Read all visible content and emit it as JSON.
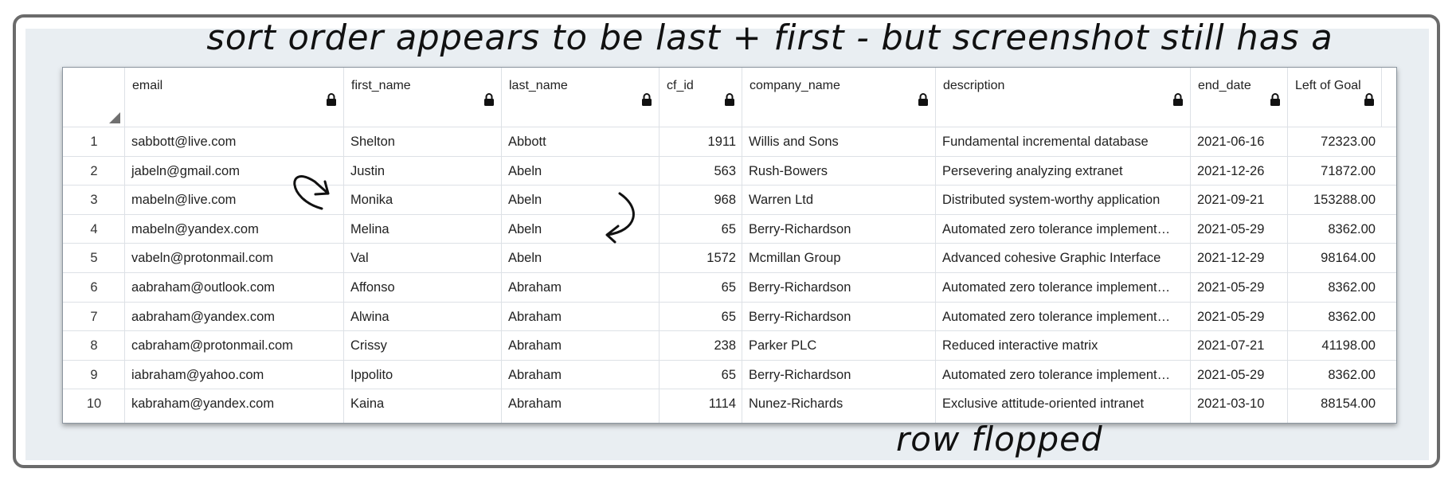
{
  "annotations": {
    "top_note": "sort order appears to be last + first - but screenshot still has a",
    "bottom_note": "row flopped"
  },
  "table": {
    "columns": [
      {
        "label": "",
        "key": "rownum"
      },
      {
        "label": "email",
        "key": "email"
      },
      {
        "label": "first_name",
        "key": "first_name"
      },
      {
        "label": "last_name",
        "key": "last_name"
      },
      {
        "label": "cf_id",
        "key": "cf_id"
      },
      {
        "label": "company_name",
        "key": "company_name"
      },
      {
        "label": "description",
        "key": "description"
      },
      {
        "label": "end_date",
        "key": "end_date"
      },
      {
        "label": "Left of Goal",
        "key": "left_of_goal"
      }
    ],
    "rows": [
      {
        "rownum": "1",
        "email": "sabbott@live.com",
        "first_name": "Shelton",
        "last_name": "Abbott",
        "cf_id": "1911",
        "company_name": "Willis and Sons",
        "description": "Fundamental incremental database",
        "end_date": "2021-06-16",
        "left_of_goal": "72323.00"
      },
      {
        "rownum": "2",
        "email": "jabeln@gmail.com",
        "first_name": "Justin",
        "last_name": "Abeln",
        "cf_id": "563",
        "company_name": "Rush-Bowers",
        "description": "Persevering analyzing extranet",
        "end_date": "2021-12-26",
        "left_of_goal": "71872.00"
      },
      {
        "rownum": "3",
        "email": "mabeln@live.com",
        "first_name": "Monika",
        "last_name": "Abeln",
        "cf_id": "968",
        "company_name": "Warren Ltd",
        "description": "Distributed system-worthy application",
        "end_date": "2021-09-21",
        "left_of_goal": "153288.00"
      },
      {
        "rownum": "4",
        "email": "mabeln@yandex.com",
        "first_name": "Melina",
        "last_name": "Abeln",
        "cf_id": "65",
        "company_name": "Berry-Richardson",
        "description": "Automated zero tolerance implement…",
        "end_date": "2021-05-29",
        "left_of_goal": "8362.00"
      },
      {
        "rownum": "5",
        "email": "vabeln@protonmail.com",
        "first_name": "Val",
        "last_name": "Abeln",
        "cf_id": "1572",
        "company_name": "Mcmillan Group",
        "description": "Advanced cohesive Graphic Interface",
        "end_date": "2021-12-29",
        "left_of_goal": "98164.00"
      },
      {
        "rownum": "6",
        "email": "aabraham@outlook.com",
        "first_name": "Affonso",
        "last_name": "Abraham",
        "cf_id": "65",
        "company_name": "Berry-Richardson",
        "description": "Automated zero tolerance implement…",
        "end_date": "2021-05-29",
        "left_of_goal": "8362.00"
      },
      {
        "rownum": "7",
        "email": "aabraham@yandex.com",
        "first_name": "Alwina",
        "last_name": "Abraham",
        "cf_id": "65",
        "company_name": "Berry-Richardson",
        "description": "Automated zero tolerance implement…",
        "end_date": "2021-05-29",
        "left_of_goal": "8362.00"
      },
      {
        "rownum": "8",
        "email": "cabraham@protonmail.com",
        "first_name": "Crissy",
        "last_name": "Abraham",
        "cf_id": "238",
        "company_name": "Parker PLC",
        "description": "Reduced interactive matrix",
        "end_date": "2021-07-21",
        "left_of_goal": "41198.00"
      },
      {
        "rownum": "9",
        "email": "iabraham@yahoo.com",
        "first_name": "Ippolito",
        "last_name": "Abraham",
        "cf_id": "65",
        "company_name": "Berry-Richardson",
        "description": "Automated zero tolerance implement…",
        "end_date": "2021-05-29",
        "left_of_goal": "8362.00"
      },
      {
        "rownum": "10",
        "email": "kabraham@yandex.com",
        "first_name": "Kaina",
        "last_name": "Abraham",
        "cf_id": "1114",
        "company_name": "Nunez-Richards",
        "description": "Exclusive attitude-oriented intranet",
        "end_date": "2021-03-10",
        "left_of_goal": "88154.00"
      }
    ]
  },
  "icons": {
    "column_lock": "lock-icon",
    "corner": "sort-corner-icon",
    "swap_arrows": "swap-arrows-icon"
  },
  "colors": {
    "highlight": "#f8d664",
    "frame": "#6b6b6b",
    "background": "#e9eef2"
  }
}
